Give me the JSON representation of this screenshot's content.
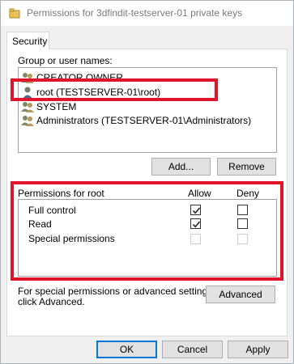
{
  "window": {
    "title": "Permissions for 3dfindit-testserver-01 private keys",
    "tab_label": "Security"
  },
  "groups": {
    "label": "Group or user names:",
    "items": [
      {
        "name": "CREATOR OWNER",
        "icon": "user-group-icon"
      },
      {
        "name": "root (TESTSERVER-01\\root)",
        "icon": "user-icon"
      },
      {
        "name": "SYSTEM",
        "icon": "user-group-icon"
      },
      {
        "name": "Administrators (TESTSERVER-01\\Administrators)",
        "icon": "user-group-icon"
      }
    ],
    "add_label": "Add...",
    "remove_label": "Remove"
  },
  "permissions": {
    "header": "Permissions for root",
    "allow_label": "Allow",
    "deny_label": "Deny",
    "rows": [
      {
        "name": "Full control",
        "allow": true,
        "deny": false,
        "enabled": true
      },
      {
        "name": "Read",
        "allow": true,
        "deny": false,
        "enabled": true
      },
      {
        "name": "Special permissions",
        "allow": false,
        "deny": false,
        "enabled": false
      }
    ]
  },
  "advanced": {
    "text_line1": "For special permissions or advanced settings,",
    "text_line2": "click Advanced.",
    "button_label": "Advanced"
  },
  "footer": {
    "ok_label": "OK",
    "cancel_label": "Cancel",
    "apply_label": "Apply"
  },
  "colors": {
    "highlight": "#e0142a",
    "focus_border": "#0078d7"
  }
}
